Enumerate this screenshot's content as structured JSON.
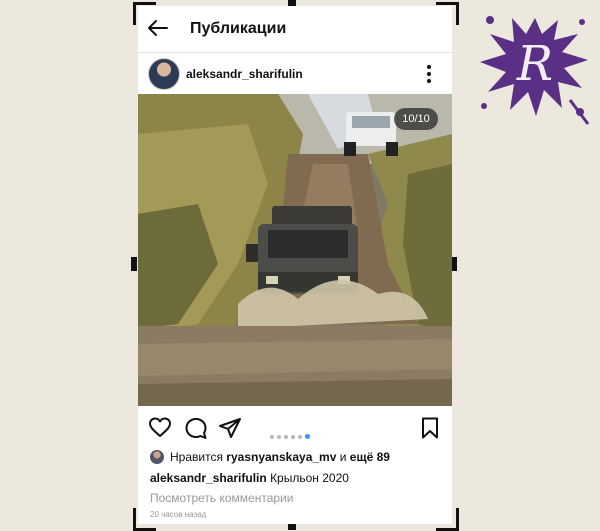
{
  "header": {
    "title": "Публикации"
  },
  "post": {
    "username": "aleksandr_sharifulin",
    "image_counter": "10/10",
    "carousel": {
      "total_dots": 6,
      "active_index": 5
    },
    "likes": {
      "prefix": "Нравится",
      "user": "ryasnyanskaya_mv",
      "connector": "и",
      "more": "ещё 89"
    },
    "caption": {
      "user": "aleksandr_sharifulin",
      "text": "Крыльон 2020"
    },
    "view_comments": "Посмотреть комментарии",
    "timestamp": "20 часов назад"
  },
  "icons": {
    "back": "arrow-left-icon",
    "menu": "more-vertical-icon",
    "like": "heart-icon",
    "comment": "comment-icon",
    "share": "send-icon",
    "save": "bookmark-icon"
  },
  "colors": {
    "accent_dot": "#3897f0",
    "logo": "#5a2f86"
  },
  "watermark": {
    "letter": "R"
  }
}
